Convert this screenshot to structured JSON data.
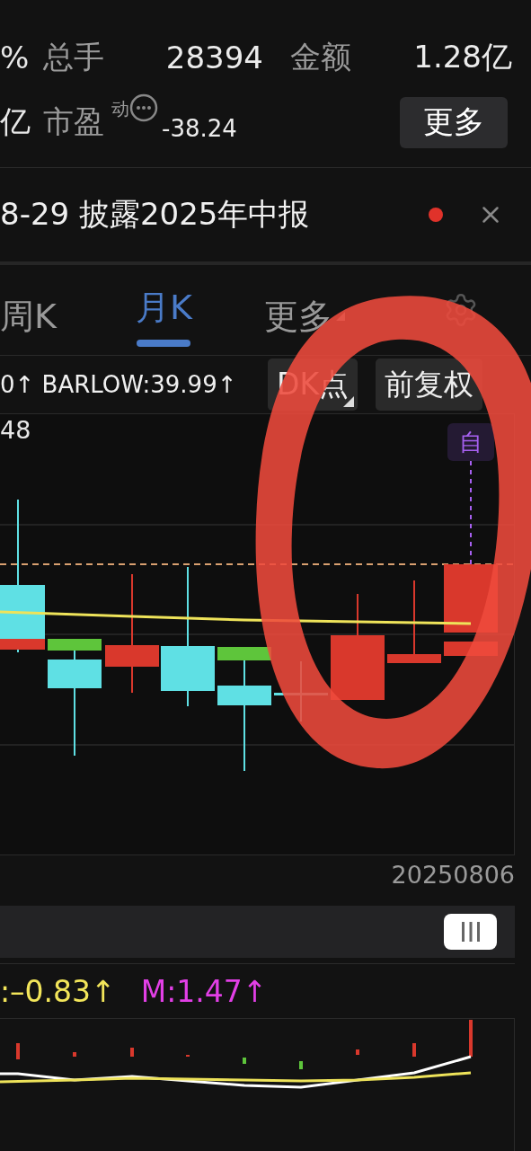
{
  "stats": {
    "cut_value_1": "%",
    "turnover_label": "总手",
    "turnover_value": "28394",
    "amount_label": "金额",
    "amount_value": "1.28亿",
    "cut_value_2": "亿",
    "pe_label": "市盈",
    "pe_superscript": "动",
    "pe_value": "-38.24",
    "more_button": "更多"
  },
  "notice": {
    "text": "8-29 披露2025年中报",
    "unread": true
  },
  "period_tabs": [
    {
      "label": "周K",
      "selected": false,
      "has_menu": false
    },
    {
      "label": "月K",
      "selected": true,
      "has_menu": false
    },
    {
      "label": "更多",
      "selected": false,
      "has_menu": true
    }
  ],
  "indicator_bar": {
    "text": "0↑ BARLOW:39.99↑",
    "dk_button": "DK点",
    "adjust_button": "前复权"
  },
  "chart": {
    "price_label": "48",
    "signal_badge": "自",
    "date": "20250806"
  },
  "macd": {
    "dea": ":–0.83↑",
    "m": "M:1.47↑"
  }
}
